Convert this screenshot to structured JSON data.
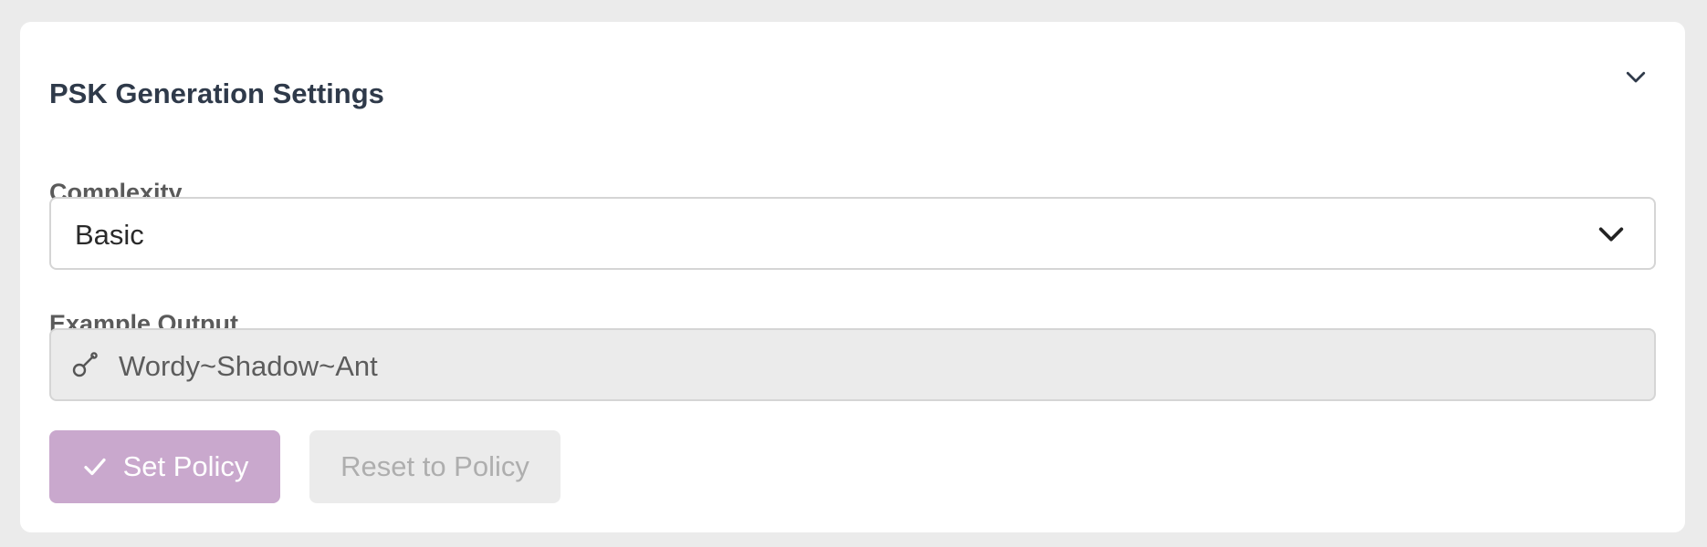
{
  "panel": {
    "title": "PSK Generation Settings",
    "collapse_icon": "chevron-down-icon"
  },
  "complexity": {
    "label": "Complexity",
    "selected_value": "Basic",
    "dropdown_icon": "chevron-down-icon"
  },
  "example_output": {
    "label": "Example Output",
    "value": "Wordy~Shadow~Ant",
    "icon": "key-icon"
  },
  "actions": {
    "set_policy_label": "Set Policy",
    "set_policy_icon": "check-icon",
    "reset_label": "Reset to Policy"
  },
  "colors": {
    "primary_button": "#c9a8cd",
    "disabled_button": "#ebebeb",
    "title_text": "#2f3a4a"
  }
}
